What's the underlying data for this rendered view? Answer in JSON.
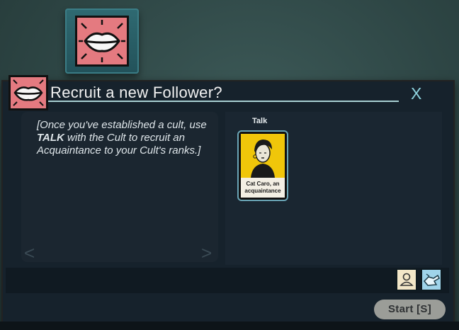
{
  "verb_tile": {
    "icon": "lips-icon",
    "color": "#e47a80"
  },
  "dialog": {
    "icon": "lips-icon",
    "title": "Recruit a new Follower?",
    "close_label": "X",
    "description": {
      "part1": "[Once you've established a cult, use ",
      "emphasis": "TALK",
      "part2": " with the Cult to recruit an Acquaintance to your Cult's ranks.]"
    },
    "prev_label": "<",
    "next_label": ">",
    "slot": {
      "label": "Talk",
      "card": {
        "caption": "Cat Caro, an acquaintance",
        "color": "#f0c60a"
      }
    },
    "aspects": [
      {
        "icon": "person-icon",
        "color": "#f2e6c8"
      },
      {
        "icon": "hand-icon",
        "color": "#9fd4ea"
      }
    ],
    "start_label": "Start [S]"
  }
}
